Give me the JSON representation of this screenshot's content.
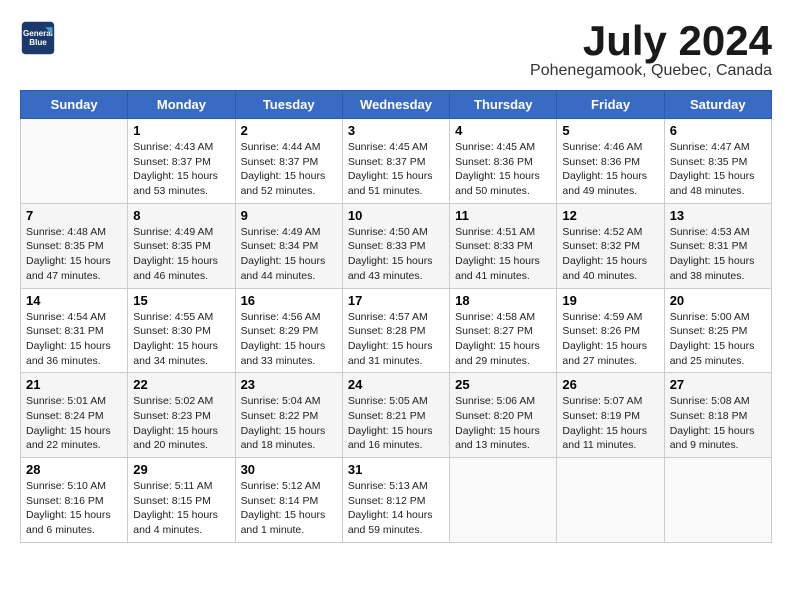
{
  "header": {
    "logo_line1": "General",
    "logo_line2": "Blue",
    "month_title": "July 2024",
    "location": "Pohenegamook, Quebec, Canada"
  },
  "days_of_week": [
    "Sunday",
    "Monday",
    "Tuesday",
    "Wednesday",
    "Thursday",
    "Friday",
    "Saturday"
  ],
  "weeks": [
    [
      {
        "day": "",
        "info": ""
      },
      {
        "day": "1",
        "info": "Sunrise: 4:43 AM\nSunset: 8:37 PM\nDaylight: 15 hours\nand 53 minutes."
      },
      {
        "day": "2",
        "info": "Sunrise: 4:44 AM\nSunset: 8:37 PM\nDaylight: 15 hours\nand 52 minutes."
      },
      {
        "day": "3",
        "info": "Sunrise: 4:45 AM\nSunset: 8:37 PM\nDaylight: 15 hours\nand 51 minutes."
      },
      {
        "day": "4",
        "info": "Sunrise: 4:45 AM\nSunset: 8:36 PM\nDaylight: 15 hours\nand 50 minutes."
      },
      {
        "day": "5",
        "info": "Sunrise: 4:46 AM\nSunset: 8:36 PM\nDaylight: 15 hours\nand 49 minutes."
      },
      {
        "day": "6",
        "info": "Sunrise: 4:47 AM\nSunset: 8:35 PM\nDaylight: 15 hours\nand 48 minutes."
      }
    ],
    [
      {
        "day": "7",
        "info": "Sunrise: 4:48 AM\nSunset: 8:35 PM\nDaylight: 15 hours\nand 47 minutes."
      },
      {
        "day": "8",
        "info": "Sunrise: 4:49 AM\nSunset: 8:35 PM\nDaylight: 15 hours\nand 46 minutes."
      },
      {
        "day": "9",
        "info": "Sunrise: 4:49 AM\nSunset: 8:34 PM\nDaylight: 15 hours\nand 44 minutes."
      },
      {
        "day": "10",
        "info": "Sunrise: 4:50 AM\nSunset: 8:33 PM\nDaylight: 15 hours\nand 43 minutes."
      },
      {
        "day": "11",
        "info": "Sunrise: 4:51 AM\nSunset: 8:33 PM\nDaylight: 15 hours\nand 41 minutes."
      },
      {
        "day": "12",
        "info": "Sunrise: 4:52 AM\nSunset: 8:32 PM\nDaylight: 15 hours\nand 40 minutes."
      },
      {
        "day": "13",
        "info": "Sunrise: 4:53 AM\nSunset: 8:31 PM\nDaylight: 15 hours\nand 38 minutes."
      }
    ],
    [
      {
        "day": "14",
        "info": "Sunrise: 4:54 AM\nSunset: 8:31 PM\nDaylight: 15 hours\nand 36 minutes."
      },
      {
        "day": "15",
        "info": "Sunrise: 4:55 AM\nSunset: 8:30 PM\nDaylight: 15 hours\nand 34 minutes."
      },
      {
        "day": "16",
        "info": "Sunrise: 4:56 AM\nSunset: 8:29 PM\nDaylight: 15 hours\nand 33 minutes."
      },
      {
        "day": "17",
        "info": "Sunrise: 4:57 AM\nSunset: 8:28 PM\nDaylight: 15 hours\nand 31 minutes."
      },
      {
        "day": "18",
        "info": "Sunrise: 4:58 AM\nSunset: 8:27 PM\nDaylight: 15 hours\nand 29 minutes."
      },
      {
        "day": "19",
        "info": "Sunrise: 4:59 AM\nSunset: 8:26 PM\nDaylight: 15 hours\nand 27 minutes."
      },
      {
        "day": "20",
        "info": "Sunrise: 5:00 AM\nSunset: 8:25 PM\nDaylight: 15 hours\nand 25 minutes."
      }
    ],
    [
      {
        "day": "21",
        "info": "Sunrise: 5:01 AM\nSunset: 8:24 PM\nDaylight: 15 hours\nand 22 minutes."
      },
      {
        "day": "22",
        "info": "Sunrise: 5:02 AM\nSunset: 8:23 PM\nDaylight: 15 hours\nand 20 minutes."
      },
      {
        "day": "23",
        "info": "Sunrise: 5:04 AM\nSunset: 8:22 PM\nDaylight: 15 hours\nand 18 minutes."
      },
      {
        "day": "24",
        "info": "Sunrise: 5:05 AM\nSunset: 8:21 PM\nDaylight: 15 hours\nand 16 minutes."
      },
      {
        "day": "25",
        "info": "Sunrise: 5:06 AM\nSunset: 8:20 PM\nDaylight: 15 hours\nand 13 minutes."
      },
      {
        "day": "26",
        "info": "Sunrise: 5:07 AM\nSunset: 8:19 PM\nDaylight: 15 hours\nand 11 minutes."
      },
      {
        "day": "27",
        "info": "Sunrise: 5:08 AM\nSunset: 8:18 PM\nDaylight: 15 hours\nand 9 minutes."
      }
    ],
    [
      {
        "day": "28",
        "info": "Sunrise: 5:10 AM\nSunset: 8:16 PM\nDaylight: 15 hours\nand 6 minutes."
      },
      {
        "day": "29",
        "info": "Sunrise: 5:11 AM\nSunset: 8:15 PM\nDaylight: 15 hours\nand 4 minutes."
      },
      {
        "day": "30",
        "info": "Sunrise: 5:12 AM\nSunset: 8:14 PM\nDaylight: 15 hours\nand 1 minute."
      },
      {
        "day": "31",
        "info": "Sunrise: 5:13 AM\nSunset: 8:12 PM\nDaylight: 14 hours\nand 59 minutes."
      },
      {
        "day": "",
        "info": ""
      },
      {
        "day": "",
        "info": ""
      },
      {
        "day": "",
        "info": ""
      }
    ]
  ]
}
